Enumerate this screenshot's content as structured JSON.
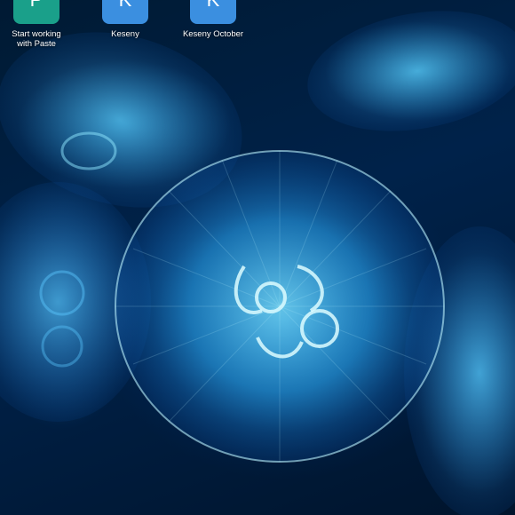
{
  "desktop": {
    "icons": [
      {
        "letter": "P",
        "label_line1": "Start working",
        "label_line2": "with Paste",
        "color": "#1aa08a"
      },
      {
        "letter": "K",
        "label_line1": "Keseny",
        "label_line2": "",
        "color": "#3b8fe0"
      },
      {
        "letter": "K",
        "label_line1": "Keseny October",
        "label_line2": "",
        "color": "#3b8fe0"
      }
    ],
    "wallpaper": {
      "subject": "jellyfish",
      "accent": "#3fc4ff",
      "background": "#00142c"
    }
  }
}
